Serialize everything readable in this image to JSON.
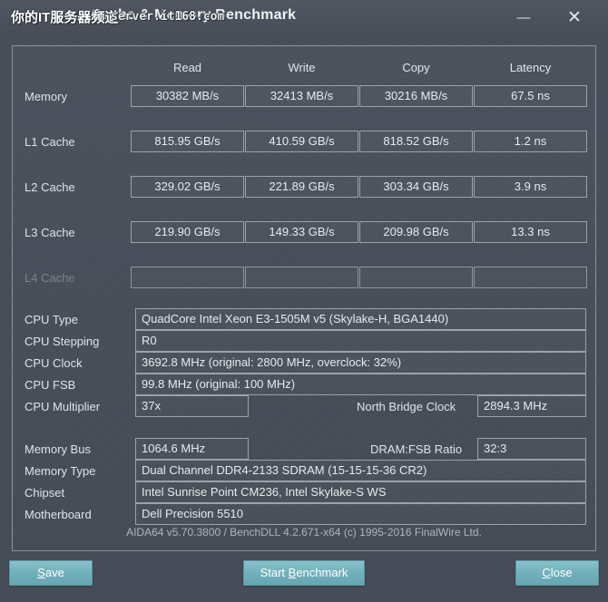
{
  "window": {
    "title": "Cache & Memory Benchmark",
    "watermark_cn": "你的IT服务器频道",
    "watermark_url": "server.it168.com",
    "minimize_icon": "minimize-icon",
    "close_icon": "close-icon",
    "minimize_glyph": "—",
    "close_glyph": "✕"
  },
  "benchmark": {
    "columns": [
      "Read",
      "Write",
      "Copy",
      "Latency"
    ],
    "rows": [
      {
        "label": "Memory",
        "values": [
          "30382 MB/s",
          "32413 MB/s",
          "30216 MB/s",
          "67.5 ns"
        ],
        "disabled": false
      },
      {
        "label": "L1 Cache",
        "values": [
          "815.95 GB/s",
          "410.59 GB/s",
          "818.52 GB/s",
          "1.2 ns"
        ],
        "disabled": false
      },
      {
        "label": "L2 Cache",
        "values": [
          "329.02 GB/s",
          "221.89 GB/s",
          "303.34 GB/s",
          "3.9 ns"
        ],
        "disabled": false
      },
      {
        "label": "L3 Cache",
        "values": [
          "219.90 GB/s",
          "149.33 GB/s",
          "209.98 GB/s",
          "13.3 ns"
        ],
        "disabled": false
      },
      {
        "label": "L4 Cache",
        "values": [
          "",
          "",
          "",
          ""
        ],
        "disabled": true
      }
    ]
  },
  "cpu_info": {
    "type_label": "CPU Type",
    "type_value": "QuadCore Intel Xeon E3-1505M v5  (Skylake-H, BGA1440)",
    "stepping_label": "CPU Stepping",
    "stepping_value": "R0",
    "clock_label": "CPU Clock",
    "clock_value": "3692.8 MHz  (original: 2800 MHz, overclock: 32%)",
    "fsb_label": "CPU FSB",
    "fsb_value": "99.8 MHz  (original: 100 MHz)",
    "multiplier_label": "CPU Multiplier",
    "multiplier_value": "37x",
    "north_bridge_label": "North Bridge Clock",
    "north_bridge_value": "2894.3 MHz"
  },
  "memory_info": {
    "bus_label": "Memory Bus",
    "bus_value": "1064.6 MHz",
    "ratio_label": "DRAM:FSB Ratio",
    "ratio_value": "32:3",
    "type_label": "Memory Type",
    "type_value": "Dual Channel DDR4-2133 SDRAM  (15-15-15-36 CR2)",
    "chipset_label": "Chipset",
    "chipset_value": "Intel Sunrise Point CM236, Intel Skylake-S WS",
    "motherboard_label": "Motherboard",
    "motherboard_value": "Dell Precision 5510"
  },
  "footer": {
    "version_text": "AIDA64 v5.70.3800 / BenchDLL 4.2.671-x64  (c) 1995-2016 FinalWire Ltd."
  },
  "buttons": {
    "save": {
      "prefix": "",
      "accel": "S",
      "suffix": "ave"
    },
    "start": {
      "prefix": "Start ",
      "accel": "B",
      "suffix": "enchmark"
    },
    "close": {
      "prefix": "",
      "accel": "C",
      "suffix": "lose"
    }
  },
  "colors": {
    "window_bg": "#464d58",
    "panel_border": "#8b939d",
    "field_border": "#9aa2ac",
    "text": "#e2e6eb",
    "text_dim": "#7b838e",
    "button_teal": "#72b0bb"
  }
}
